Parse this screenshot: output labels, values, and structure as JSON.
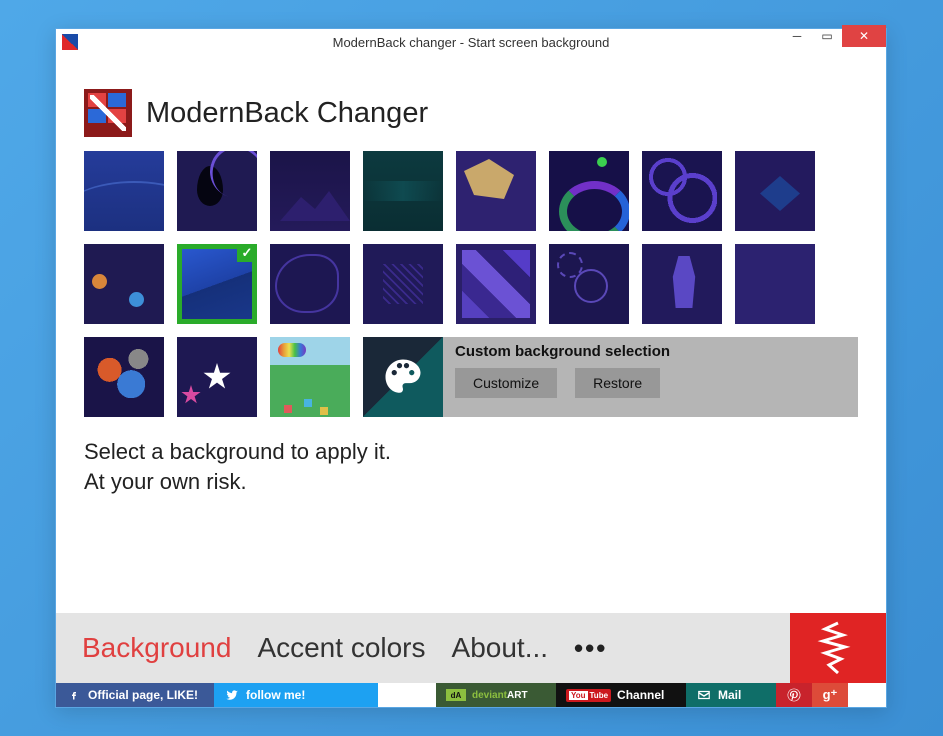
{
  "window": {
    "title": "ModernBack changer - Start screen background"
  },
  "header": {
    "app_name": "ModernBack Changer"
  },
  "custom": {
    "title": "Custom background selection",
    "customize_label": "Customize",
    "restore_label": "Restore"
  },
  "info": {
    "line1": "Select a background to apply it.",
    "line2": "At your own risk."
  },
  "nav": {
    "background": "Background",
    "accent": "Accent colors",
    "about": "About...",
    "more": "•••"
  },
  "social": {
    "fb": "Official page, LIKE!",
    "tw": "follow me!",
    "da": "deviantART",
    "yt": "Channel",
    "mail": "Mail"
  }
}
